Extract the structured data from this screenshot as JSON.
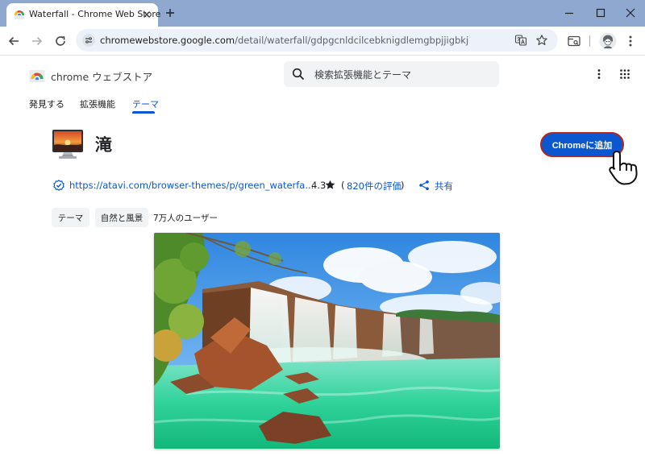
{
  "browser": {
    "tab_title": "Waterfall - Chrome Web Store",
    "url_host": "chromewebstore.google.com",
    "url_path": "/detail/waterfall/gdpgcnldcilcebknigdlemgbpjjigbkj"
  },
  "store": {
    "name": "chrome ウェブストア",
    "search_placeholder": "検索拡張機能とテーマ",
    "tabs": [
      {
        "label": "発見する"
      },
      {
        "label": "拡張機能"
      },
      {
        "label": "テーマ"
      }
    ]
  },
  "item": {
    "title": "滝",
    "add_button_label": "Chromeに追加",
    "site_link": "https://atavi.com/browser-themes/p/green_waterfa...",
    "rating": "4.3",
    "reviews": "820件の評価",
    "share_label": "共有",
    "chips": [
      {
        "label": "テーマ"
      },
      {
        "label": "自然と風景"
      }
    ],
    "users": "7万人のユーザー"
  },
  "colors": {
    "accent": "#0b57d0",
    "add_button_border": "#b3261e",
    "tabbar": "#8ea8cf",
    "omnibox": "#edf2fa"
  }
}
